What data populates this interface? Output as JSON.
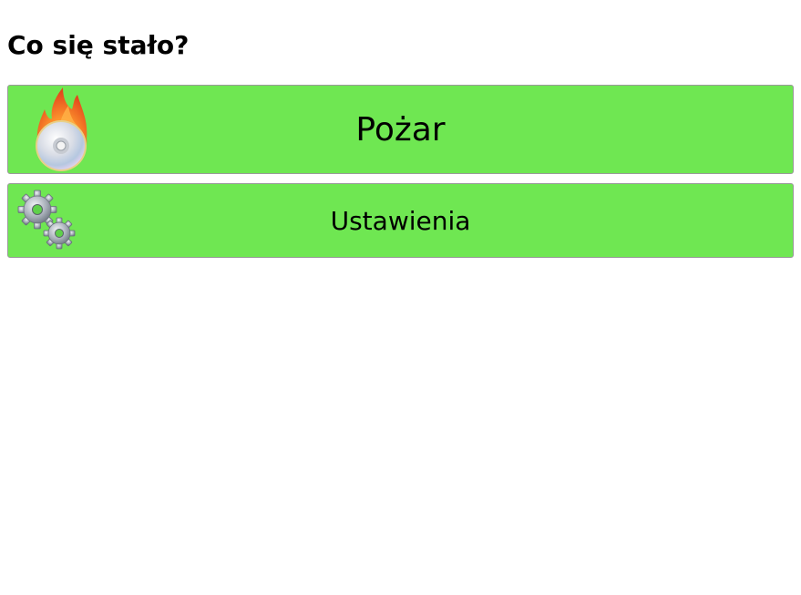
{
  "question": "Co się stało?",
  "buttons": {
    "fire": {
      "label": "Pożar",
      "icon": "burning-disc-icon"
    },
    "settings": {
      "label": "Ustawienia",
      "icon": "gears-icon"
    }
  },
  "colors": {
    "button_background": "#6fe752",
    "button_border": "#9a9a9a"
  }
}
